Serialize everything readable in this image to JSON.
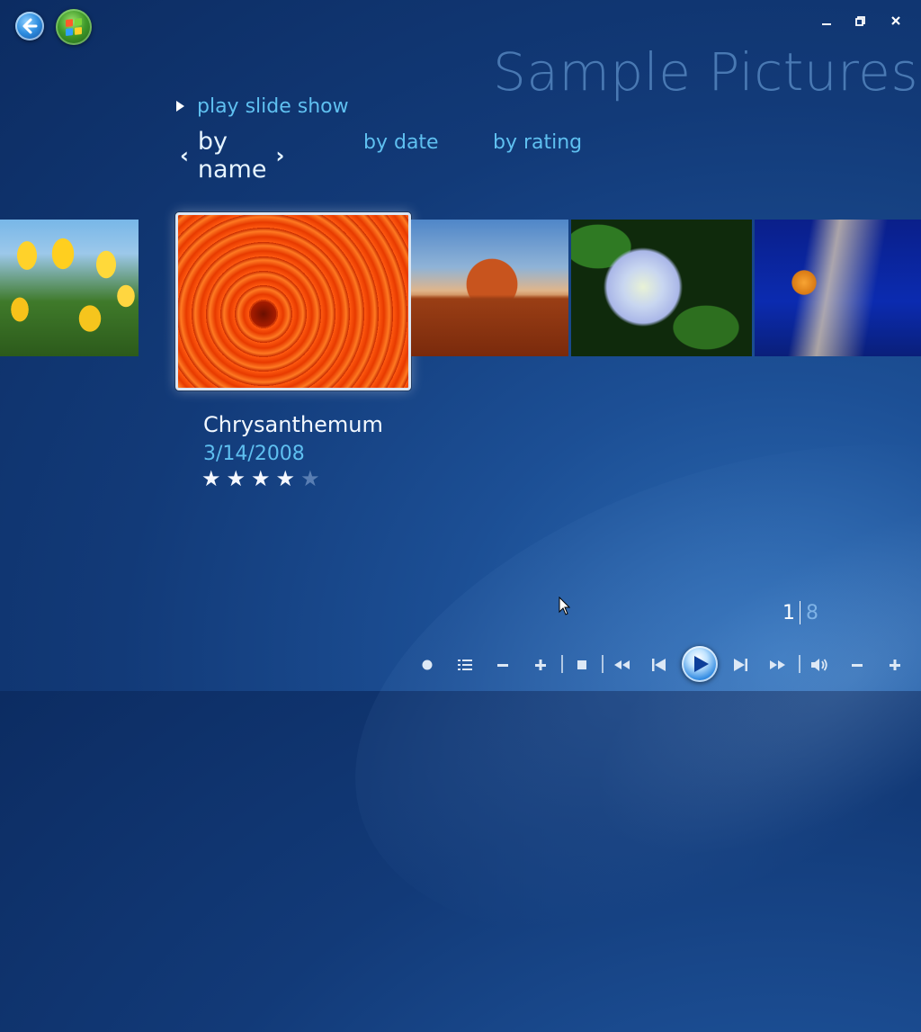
{
  "window": {
    "title": "Sample Pictures",
    "minimize_icon": "minimize-icon",
    "restore_icon": "restore-icon",
    "close_icon": "close-icon"
  },
  "nav": {
    "back_icon": "back-arrow-icon",
    "start_icon": "windows-start-orb-icon"
  },
  "menu": {
    "play_slide_show": "play slide show"
  },
  "sort": {
    "active": "by name",
    "options": [
      "by date",
      "by rating"
    ]
  },
  "gallery": {
    "items": [
      {
        "name": "tulips-thumbnail"
      },
      {
        "name": "chrysanthemum-thumbnail",
        "selected": true
      },
      {
        "name": "desert-thumbnail"
      },
      {
        "name": "hydrangeas-thumbnail"
      },
      {
        "name": "jellyfish-thumbnail"
      }
    ]
  },
  "selected": {
    "title": "Chrysanthemum",
    "date": "3/14/2008",
    "rating": 4,
    "rating_max": 5
  },
  "pager": {
    "current": "1",
    "total": "8"
  },
  "transport": {
    "icons": [
      "record-icon",
      "guide-list-icon",
      "channel-down-icon",
      "channel-up-icon",
      "stop-icon",
      "rewind-icon",
      "previous-icon",
      "play-icon",
      "next-icon",
      "fast-forward-icon",
      "mute-icon",
      "volume-down-icon",
      "volume-up-icon"
    ]
  },
  "colors": {
    "accent_text": "#5fc0f0",
    "background": "#123a78"
  }
}
